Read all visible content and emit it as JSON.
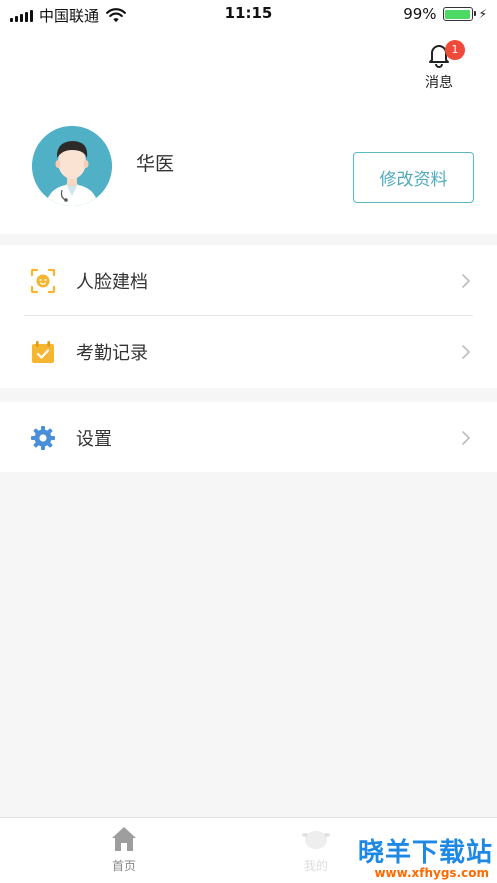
{
  "status_bar": {
    "carrier": "中国联通",
    "time": "11:15",
    "battery": "99%",
    "battery_level": 0.99
  },
  "header": {
    "message_label": "消息",
    "message_badge": "1",
    "user_name": "华医",
    "edit_profile_label": "修改资料"
  },
  "menu": {
    "face_archive": "人脸建档",
    "attendance": "考勤记录",
    "settings": "设置"
  },
  "tabbar": {
    "home_label": "首页",
    "mine_label": "我的"
  },
  "watermark": {
    "brand": "晓羊下载站",
    "url": "www.xfhygs.com"
  },
  "colors": {
    "accent": "#4eaabb",
    "badge": "#f04a3a",
    "icon_yellow": "#f5b731",
    "icon_blue": "#4a90d9"
  }
}
